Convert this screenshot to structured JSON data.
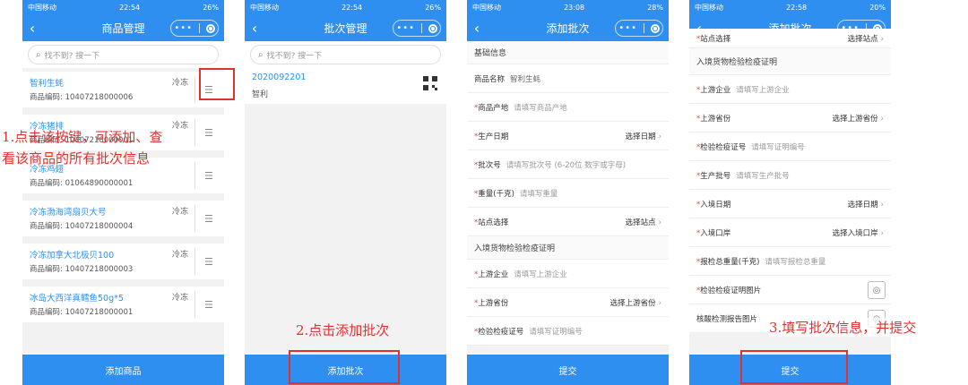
{
  "phone1": {
    "status": {
      "carrier": "中国移动",
      "time": "22:54",
      "battery": "26%"
    },
    "title": "商品管理",
    "search_placeholder": "找不到? 搜一下",
    "items": [
      {
        "name": "智利生蚝",
        "tag": "冷冻",
        "code": "商品编码: 10407218000006"
      },
      {
        "name": "冷冻猪排",
        "tag": "冷冻",
        "code": "商品编码: 10407218000001"
      },
      {
        "name": "冷冻鸡翅",
        "tag": "",
        "code": "商品编码: 01064890000001"
      },
      {
        "name": "冷冻渤海湾扇贝大号",
        "tag": "冷冻",
        "code": "商品编码: 10407218000004"
      },
      {
        "name": "冷冻加拿大北极贝100",
        "tag": "冷冻",
        "code": "商品编码: 10407218000003"
      },
      {
        "name": "冰岛大西洋真鳕鱼50g*5",
        "tag": "冷冻",
        "code": "商品编码: 10407218000001"
      }
    ],
    "bottom_button": "添加商品"
  },
  "phone2": {
    "status": {
      "carrier": "中国移动",
      "time": "22:54",
      "battery": "26%"
    },
    "title": "批次管理",
    "search_placeholder": "找不到? 搜一下",
    "batch": {
      "number": "2020092201",
      "name": "智利"
    },
    "bottom_button": "添加批次"
  },
  "phone3": {
    "status": {
      "carrier": "中国移动",
      "time": "23:08",
      "battery": "28%"
    },
    "title": "添加批次",
    "basic_section": "基础信息",
    "rows": {
      "product_name_label": "商品名称",
      "product_name_value": "智利生蚝",
      "origin_label": "商品产地",
      "origin_ph": "请填写商品产地",
      "date_label": "生产日期",
      "date_select": "选择日期",
      "batch_label": "批次号",
      "batch_ph": "请填写批次号 (6-20位 数字或字母)",
      "weight_label": "重量(千克)",
      "weight_ph": "请填写重量",
      "site_label": "站点选择",
      "site_select": "选择站点"
    },
    "inspect_section": "入境货物检验检疫证明",
    "rows2": {
      "upstream_label": "上游企业",
      "upstream_ph": "请填写上游企业",
      "province_label": "上游省份",
      "province_select": "选择上游省份",
      "cert_label": "检验检疫证号",
      "cert_ph": "请填写证明编号"
    },
    "bottom_button": "提交"
  },
  "phone4": {
    "status": {
      "carrier": "中国移动",
      "time": "22:58",
      "battery": "20%"
    },
    "title": "添加批次",
    "site_label": "站点选择",
    "site_select": "选择站点",
    "section": "入境货物检验检疫证明",
    "upstream_label": "上游企业",
    "upstream_ph": "请填写上游企业",
    "province_label": "上游省份",
    "province_select": "选择上游省份",
    "cert_label": "检验检疫证号",
    "cert_ph": "请填写证明编号",
    "prod_batch_label": "生产批号",
    "prod_batch_ph": "请填写生产批号",
    "entry_date_label": "入境日期",
    "entry_date_select": "选择日期",
    "entry_port_label": "入境口岸",
    "entry_port_select": "选择入境口岸",
    "declared_weight_label": "报检总重量(千克)",
    "declared_weight_ph": "请填写报检总重量",
    "cert_image_label": "检验检疫证明图片",
    "nucleic_label": "核酸检测报告图片",
    "bottom_button": "提交"
  },
  "annotations": {
    "step1_line1": "1.点击该按键，可添加、查",
    "step1_line2": "看该商品的所有批次信息",
    "step2": "2.点击添加批次",
    "step3": "3.填写批次信息，并提交"
  }
}
